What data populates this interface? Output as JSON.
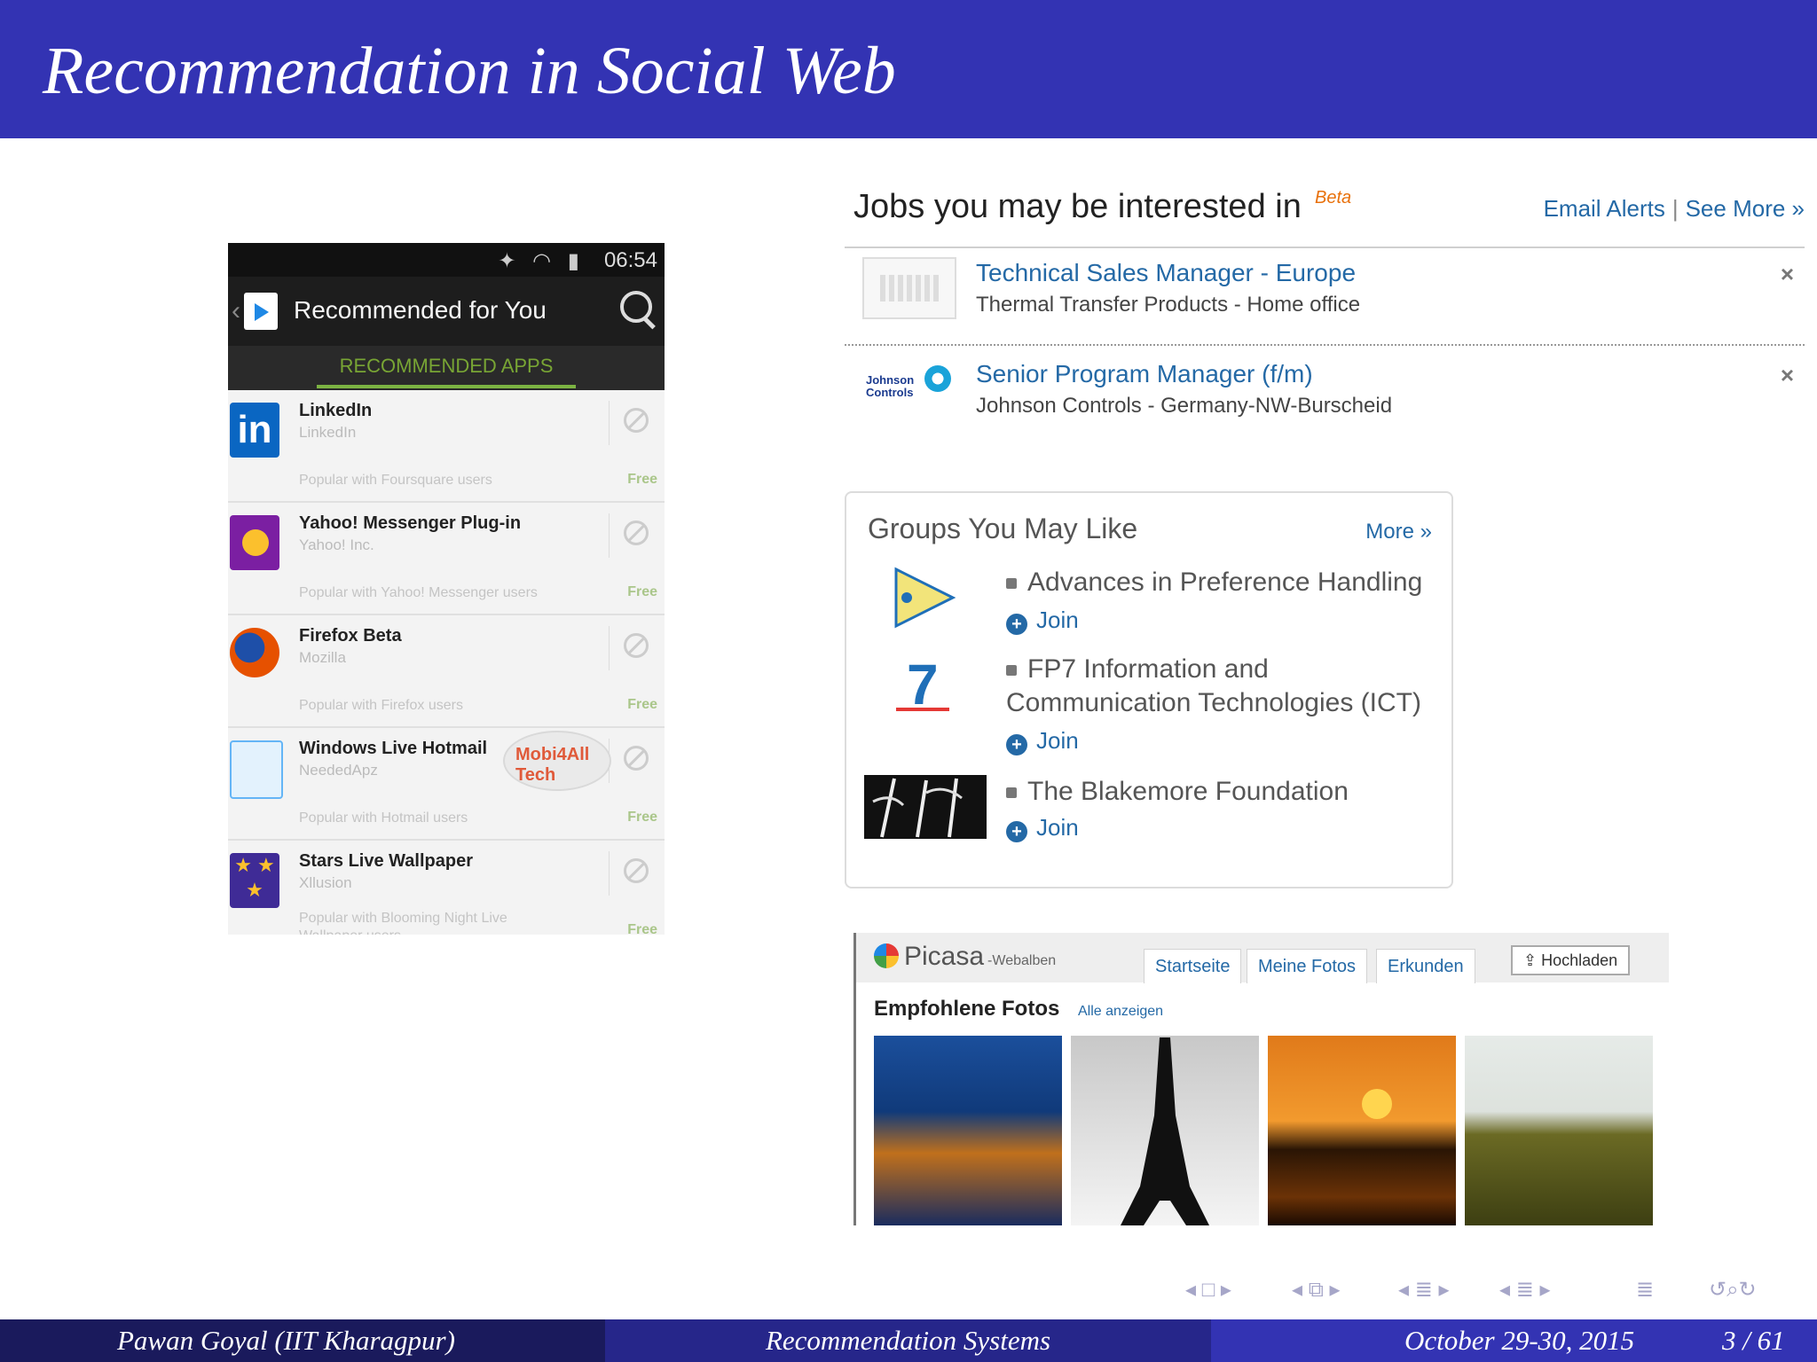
{
  "slide": {
    "title": "Recommendation in Social Web",
    "footer": {
      "author": "Pawan Goyal  (IIT Kharagpur)",
      "talk": "Recommendation Systems",
      "date": "October 29-30, 2015",
      "page": "3 / 61"
    }
  },
  "phone": {
    "time": "06:54",
    "app_title": "Recommended for You",
    "subtab": "RECOMMENDED APPS",
    "watermark": "Mobi4All Tech",
    "apps": [
      {
        "name": "LinkedIn",
        "developer": "LinkedIn",
        "popular": "Popular with Foursquare users",
        "price": "Free",
        "icon_color": "#0a66c2"
      },
      {
        "name": "Yahoo! Messenger Plug-in",
        "developer": "Yahoo! Inc.",
        "popular": "Popular with Yahoo! Messenger users",
        "price": "Free",
        "icon_color": "#7b1fa2"
      },
      {
        "name": "Firefox Beta",
        "developer": "Mozilla",
        "popular": "Popular with Firefox users",
        "price": "Free",
        "icon_color": "#e65100"
      },
      {
        "name": "Windows Live Hotmail",
        "developer": "NeededApz",
        "popular": "Popular with Hotmail users",
        "price": "Free",
        "icon_color": "#64b5f6"
      },
      {
        "name": "Stars Live Wallpaper",
        "developer": "Xllusion",
        "popular": "Popular with Blooming Night Live Wallpaper users",
        "price": "Free",
        "icon_color": "#3f2b96"
      }
    ]
  },
  "jobs": {
    "heading": "Jobs you may be interested in",
    "badge": "Beta",
    "email_alerts": "Email Alerts",
    "see_more": "See More »",
    "items": [
      {
        "title": "Technical Sales Manager - Europe",
        "subtitle": "Thermal Transfer Products - Home office",
        "logo_text": ""
      },
      {
        "title": "Senior Program Manager (f/m)",
        "subtitle": "Johnson Controls - Germany-NW-Burscheid",
        "logo_text": "Johnson Controls"
      }
    ]
  },
  "groups": {
    "heading": "Groups You May Like",
    "more": "More »",
    "join_label": "Join",
    "items": [
      {
        "name": "Advances in Preference Handling"
      },
      {
        "name": "FP7 Information and Communication Technologies (ICT)"
      },
      {
        "name": "The Blakemore Foundation"
      }
    ]
  },
  "picasa": {
    "logo": "Picasa",
    "logo_sub": "-Webalben",
    "tabs": [
      "Startseite",
      "Meine Fotos",
      "Erkunden"
    ],
    "upload": "Hochladen",
    "section_title": "Empfohlene Fotos",
    "show_all": "Alle anzeigen",
    "photos": [
      "city-night-photo",
      "eiffel-tower-photo",
      "sunset-photo",
      "sunflower-field-photo"
    ]
  },
  "colors": {
    "title_bar": "#3333b3",
    "link": "#2469a6",
    "beta": "#e8700a"
  }
}
